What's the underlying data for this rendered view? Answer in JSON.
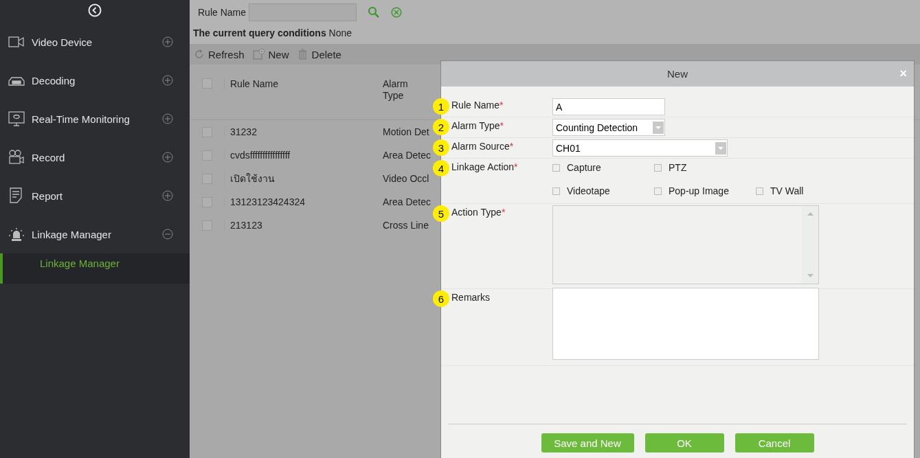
{
  "sidebar": {
    "items": [
      {
        "label": "Video Device",
        "expanded": false
      },
      {
        "label": "Decoding",
        "expanded": false
      },
      {
        "label": "Real-Time Monitoring",
        "expanded": false
      },
      {
        "label": "Record",
        "expanded": false
      },
      {
        "label": "Report",
        "expanded": false
      },
      {
        "label": "Linkage Manager",
        "expanded": true,
        "children": [
          {
            "label": "Linkage Manager",
            "selected": true
          }
        ]
      }
    ]
  },
  "search": {
    "label": "Rule Name"
  },
  "query": {
    "label": "The current query conditions",
    "value": "None"
  },
  "toolbar": [
    "Refresh",
    "New",
    "Delete"
  ],
  "table": {
    "all_checked": false,
    "columns": [
      "Rule Name",
      "Alarm Type"
    ],
    "rows": [
      {
        "checked": false,
        "cells": [
          "31232",
          "Motion Det"
        ]
      },
      {
        "checked": false,
        "cells": [
          "cvdsffffffffffffffff",
          "Area Detec"
        ]
      },
      {
        "checked": false,
        "cells": [
          "เปิดใช้งาน",
          "Video Occl"
        ]
      },
      {
        "checked": false,
        "cells": [
          "13123123424324",
          "Area Detec"
        ]
      },
      {
        "checked": false,
        "cells": [
          "213123",
          "Cross Line"
        ]
      }
    ]
  },
  "dialog": {
    "title": "New",
    "close": "×",
    "fields": [
      {
        "number": "1",
        "label": "Rule Name",
        "required_mark": "*",
        "kind": "text",
        "value": "A"
      },
      {
        "number": "2",
        "label": "Alarm Type",
        "required_mark": "*",
        "kind": "select",
        "value": "Counting Detection",
        "wide": false
      },
      {
        "number": "3",
        "label": "Alarm Source",
        "required_mark": "*",
        "kind": "select",
        "value": "CH01",
        "wide": true
      },
      {
        "number": "4",
        "label": "Linkage Action",
        "required_mark": "*",
        "kind": "checkboxes",
        "options": [
          [
            {
              "label": "Capture",
              "checked": false
            },
            {
              "label": "PTZ",
              "checked": false
            }
          ],
          [
            {
              "label": "Videotape",
              "checked": false
            },
            {
              "label": "Pop-up Image",
              "checked": false
            },
            {
              "label": "TV Wall",
              "checked": false
            }
          ]
        ]
      },
      {
        "number": "5",
        "label": "Action Type",
        "required_mark": "*",
        "kind": "list"
      },
      {
        "number": "6",
        "label": "Remarks",
        "kind": "textarea"
      }
    ],
    "buttons": [
      "Save and New",
      "OK",
      "Cancel"
    ]
  }
}
